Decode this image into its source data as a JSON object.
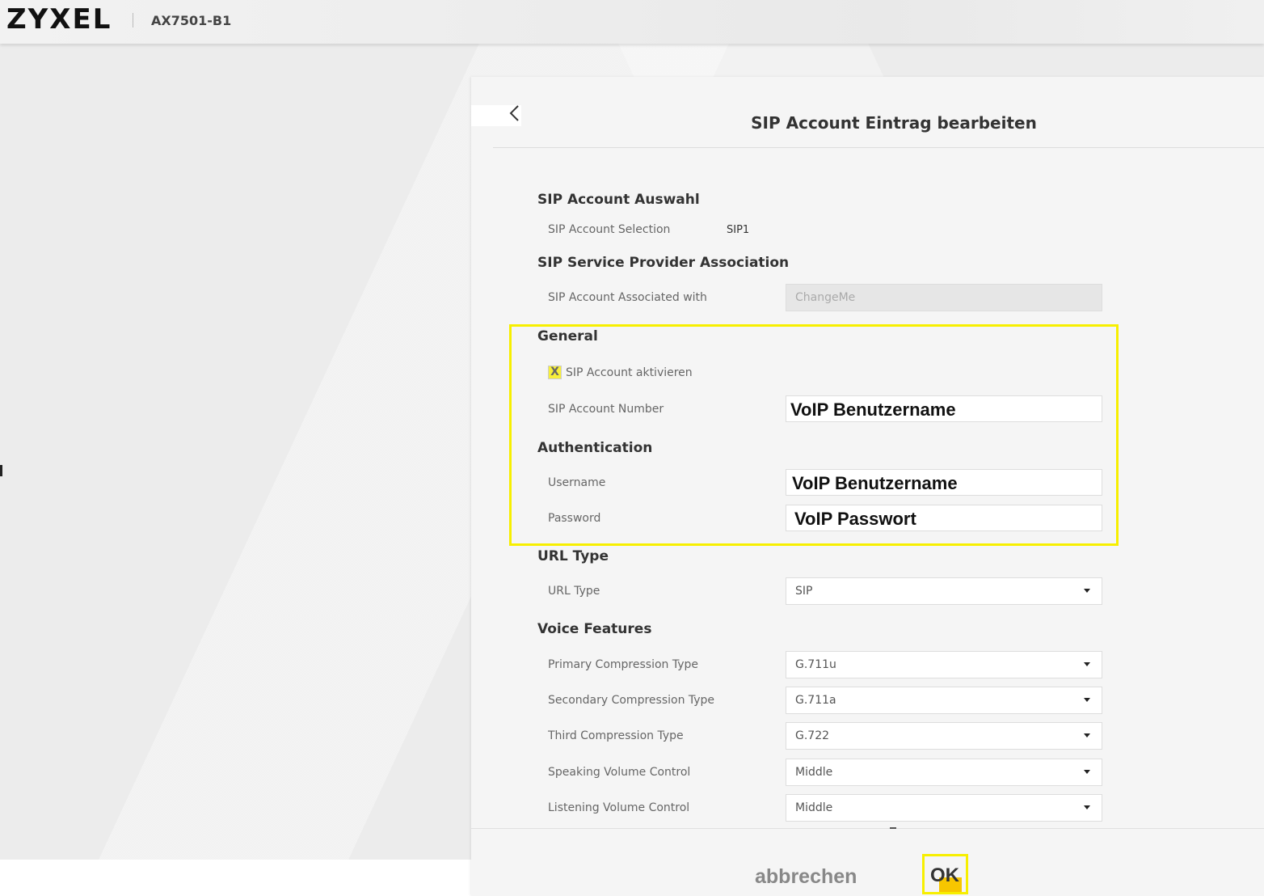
{
  "header": {
    "brand": "ZYXEL",
    "model": "AX7501-B1"
  },
  "panel": {
    "title": "SIP Account Eintrag bearbeiten"
  },
  "sections": {
    "account_select": {
      "title": "SIP Account Auswahl",
      "selection_label": "SIP Account Selection",
      "selection_value": "SIP1"
    },
    "provider": {
      "title": "SIP Service Provider Association",
      "associated_label": "SIP Account Associated with",
      "associated_value": "ChangeMe"
    },
    "general": {
      "title": "General",
      "enable_label": "SIP Account aktivieren",
      "enable_check": "X",
      "number_label": "SIP Account Number",
      "number_value": "VoIP Benutzername"
    },
    "auth": {
      "title": "Authentication",
      "username_label": "Username",
      "username_value": "VoIP Benutzername",
      "password_label": "Password",
      "password_value": "VoIP Passwort"
    },
    "url": {
      "title": "URL Type",
      "type_label": "URL Type",
      "type_value": "SIP"
    },
    "voice": {
      "title": "Voice Features",
      "primary_label": "Primary Compression Type",
      "primary_value": "G.711u",
      "secondary_label": "Secondary Compression Type",
      "secondary_value": "G.711a",
      "third_label": "Third Compression Type",
      "third_value": "G.722",
      "speaking_label": "Speaking Volume Control",
      "speaking_value": "Middle",
      "listening_label": "Listening Volume Control",
      "listening_value": "Middle"
    }
  },
  "footer": {
    "cancel_label": "abbrechen",
    "ok_label": "OK"
  },
  "colors": {
    "highlight": "#f7ef00",
    "ok_fill": "#f7c600",
    "checkbox": "#f7ef3a"
  }
}
